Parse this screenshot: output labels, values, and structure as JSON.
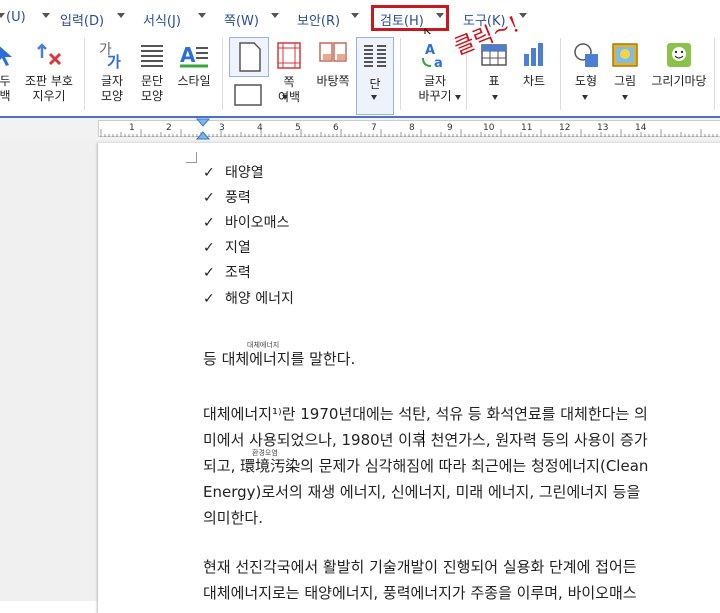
{
  "menu": {
    "items": [
      {
        "label": "(U)"
      },
      {
        "label": "입력(D)"
      },
      {
        "label": "서식(J)"
      },
      {
        "label": "쪽(W)"
      },
      {
        "label": "보안(R)"
      },
      {
        "label": "검토(H)"
      },
      {
        "label": "도구(K)"
      }
    ]
  },
  "annotation": "클릭~!",
  "ribbon": {
    "b0": {
      "l1": "두",
      "l2": "백"
    },
    "b1": {
      "l1": "조판 부호",
      "l2": "지우기"
    },
    "b2": {
      "l1": "글자",
      "l2": "모양"
    },
    "b3": {
      "l1": "문단",
      "l2": "모양"
    },
    "b4": {
      "l1": "스타일",
      "l2": ""
    },
    "b5": {
      "l1": "쪽",
      "l2": "여백"
    },
    "b6": {
      "l1": "바탕쪽",
      "l2": ""
    },
    "b7": {
      "l1": "단",
      "l2": ""
    },
    "b8": {
      "l1": "글자",
      "l2": "바꾸기"
    },
    "b9": {
      "l1": "표",
      "l2": ""
    },
    "b10": {
      "l1": "차트",
      "l2": ""
    },
    "b11": {
      "l1": "도형",
      "l2": ""
    },
    "b12": {
      "l1": "그림",
      "l2": ""
    },
    "b13": {
      "l1": "그리기마당",
      "l2": ""
    }
  },
  "ruler": {
    "numbers": [
      "1",
      "2",
      "3",
      "4",
      "5",
      "6",
      "7",
      "8",
      "9",
      "10",
      "11",
      "12",
      "13",
      "14"
    ]
  },
  "document": {
    "bullets": [
      "태양열",
      "풍력",
      "바이오매스",
      "지열",
      "조력",
      "해양 에너지"
    ],
    "check": "✓",
    "ruby1": "대체에너지",
    "ruby2": "환경오염",
    "p1": "등 대체에너지를 말한다.",
    "p2": [
      "대체에너지¹⁾란 1970년대에는 석탄, 석유 등 화석연료를 대체한다는 의",
      "미에서 사용되었으나, 1980년 이후 천연가스, 원자력 등의 사용이 증가",
      "되고, 環境汚染의 문제가 심각해짐에 따라 최근에는 청정에너지(Clean",
      "Energy)로서의 재생 에너지, 신에너지, 미래 에너지, 그린에너지 등을",
      "의미한다."
    ],
    "p3": [
      "현재 선진각국에서 활발히 기술개발이 진행되어 실용화 단계에 접어든",
      "대체에너지로는 태양에너지, 풍력에너지가 주종을 이루며, 바이오매스"
    ]
  }
}
